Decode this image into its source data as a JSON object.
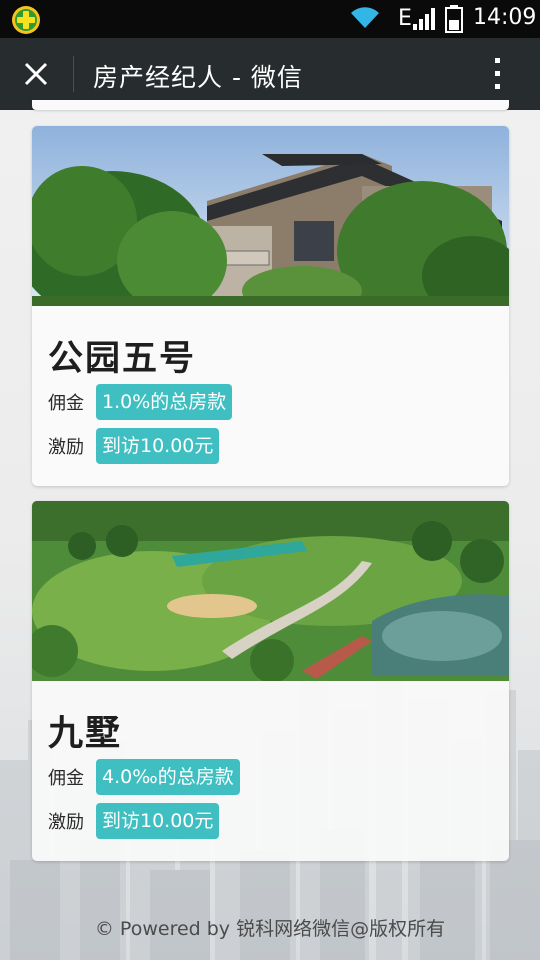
{
  "status_bar": {
    "network_type": "E",
    "time": "14:09",
    "icons": [
      "app-badge-icon",
      "wifi-icon",
      "signal-icon",
      "battery-icon"
    ]
  },
  "title_bar": {
    "title": "房产经纪人 - 微信",
    "close_icon": "close-icon",
    "more_icon": "more-vertical-icon"
  },
  "properties": [
    {
      "name": "公园五号",
      "image": "villa-building-photo",
      "commission_label": "佣金",
      "commission_value": "1.0%的总房款",
      "bonus_label": "激励",
      "bonus_value": "到访10.00元"
    },
    {
      "name": "九墅",
      "image": "park-landscape-photo",
      "commission_label": "佣金",
      "commission_value": "4.0‰的总房款",
      "bonus_label": "激励",
      "bonus_value": "到访10.00元"
    }
  ],
  "footer": {
    "text": "© Powered by 锐科网络微信@版权所有"
  },
  "colors": {
    "status_bar_bg": "#0a0a0a",
    "title_bar_bg": "#272c2f",
    "tag_bg": "#3fbfc1",
    "card_bg": "#fafafa"
  }
}
